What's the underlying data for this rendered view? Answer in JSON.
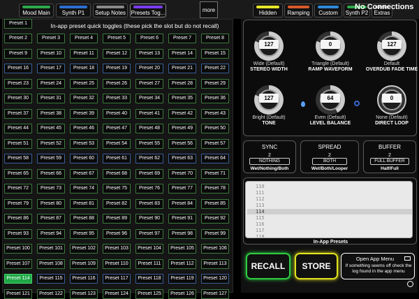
{
  "tabs": [
    {
      "label": "Mood Main",
      "color": "#2ea84a"
    },
    {
      "label": "Synth P1",
      "color": "#2e6fd0"
    },
    {
      "label": "Setup Notes",
      "color": "#8a8a8a"
    },
    {
      "label": "Presets Tog...",
      "color": "#7a3df0"
    }
  ],
  "more_label": "more",
  "right_tabs": [
    {
      "label": "Hidden",
      "color": "#e6e62a"
    },
    {
      "label": "Ramping",
      "color": "#d85a2a"
    },
    {
      "label": "Custom",
      "color": "#2e8ad8"
    },
    {
      "label": "Synth P2",
      "color": "#2ea84a"
    },
    {
      "label": "Extras",
      "color": "#888"
    }
  ],
  "status": "No Connections",
  "presets_note": "In-app preset quick toggles (these pick the slot but do not recall)",
  "presets": [
    "Preset 1",
    "Preset 2",
    "Preset 3",
    "Preset 4",
    "Preset 5",
    "Preset 6",
    "Preset 7",
    "Preset 8",
    "Preset 9",
    "Preset 10",
    "Preset 11",
    "Preset 12",
    "Preset 13",
    "Preset 14",
    "Preset 15",
    "Preset 16",
    "Preset 17",
    "Preset 18",
    "Preset 19",
    "Preset 20",
    "Preset 21",
    "Preset 22",
    "Preset 23",
    "Preset 24",
    "Preset 25",
    "Preset 26",
    "Preset 27",
    "Preset 28",
    "Preset 29",
    "Preset 30",
    "Preset 31",
    "Preset 32",
    "Preset 33",
    "Preset 34",
    "Preset 35",
    "Preset 36",
    "Preset 37",
    "Preset 38",
    "Preset 39",
    "Preset 40",
    "Preset 41",
    "Preset 42",
    "Preset 43",
    "Preset 44",
    "Preset 45",
    "Preset 46",
    "Preset 47",
    "Preset 48",
    "Preset 49",
    "Preset 50",
    "Preset 51",
    "Preset 52",
    "Preset 53",
    "Preset 54",
    "Preset 55",
    "Preset 56",
    "Preset 57",
    "Preset 58",
    "Preset 59",
    "Preset 60",
    "Preset 61",
    "Preset 62",
    "Preset 63",
    "Preset 64",
    "Preset 65",
    "Preset 66",
    "Preset 67",
    "Preset 68",
    "Preset 69",
    "Preset 70",
    "Preset 71",
    "Preset 72",
    "Preset 73",
    "Preset 74",
    "Preset 75",
    "Preset 76",
    "Preset 77",
    "Preset 78",
    "Preset 79",
    "Preset 80",
    "Preset 81",
    "Preset 82",
    "Preset 83",
    "Preset 84",
    "Preset 85",
    "Preset 86",
    "Preset 87",
    "Preset 88",
    "Preset 89",
    "Preset 90",
    "Preset 91",
    "Preset 92",
    "Preset 93",
    "Preset 94",
    "Preset 95",
    "Preset 96",
    "Preset 97",
    "Preset 98",
    "Preset 99",
    "Preset 100",
    "Preset 101",
    "Preset 102",
    "Preset 103",
    "Preset 104",
    "Preset 105",
    "Preset 106",
    "Preset 107",
    "Preset 108",
    "Preset 109",
    "Preset 110",
    "Preset 111",
    "Preset 112",
    "Preset 113",
    "Preset 114",
    "Preset 115",
    "Preset 116",
    "Preset 117",
    "Preset 118",
    "Preset 119",
    "Preset 120",
    "Preset 121",
    "Preset 122",
    "Preset 123",
    "Preset 124",
    "Preset 125",
    "Preset 126",
    "Preset 127"
  ],
  "selected_preset": "Preset 114",
  "knobs": [
    {
      "value": "127",
      "sub": "Wide (Default)",
      "name": "STEREO WIDTH"
    },
    {
      "value": "0",
      "sub": "Triangle (Default)",
      "name": "RAMP WAVEFORM"
    },
    {
      "value": "127",
      "sub": "Default",
      "name": "OVERDUB FADE TIME"
    },
    {
      "value": "127",
      "sub": "Bright (Default)",
      "name": "TONE"
    },
    {
      "value": "64",
      "sub": "Even (Default)",
      "name": "LEVEL BALANCE"
    },
    {
      "value": "0",
      "sub": "None (Default)",
      "name": "DIRECT LOOP"
    }
  ],
  "modes": [
    {
      "title": "SYNC",
      "num": "2",
      "value": "NOTHING",
      "options": "Wet/Nothing/Both"
    },
    {
      "title": "SPREAD",
      "num": "2",
      "value": "BOTH",
      "options": "Wet/Both/Looper"
    },
    {
      "title": "BUFFER",
      "num": "2",
      "value": "FULL BUFFER",
      "options": "Half/Full"
    }
  ],
  "preset_list": [
    "110",
    "111",
    "112",
    "113",
    "114",
    "115",
    "116",
    "117",
    "118"
  ],
  "preset_list_selected": "114",
  "preset_list_label": "In-App Presets",
  "recall_label": "RECALL",
  "store_label": "STORE",
  "app_menu": {
    "title": "Open App Menu",
    "note": "If something seems off check the log found in the app menu"
  },
  "colors": {
    "accent_green": "#1fa846",
    "store_yellow": "#e2e21f",
    "recall_green": "#2ecc40"
  }
}
